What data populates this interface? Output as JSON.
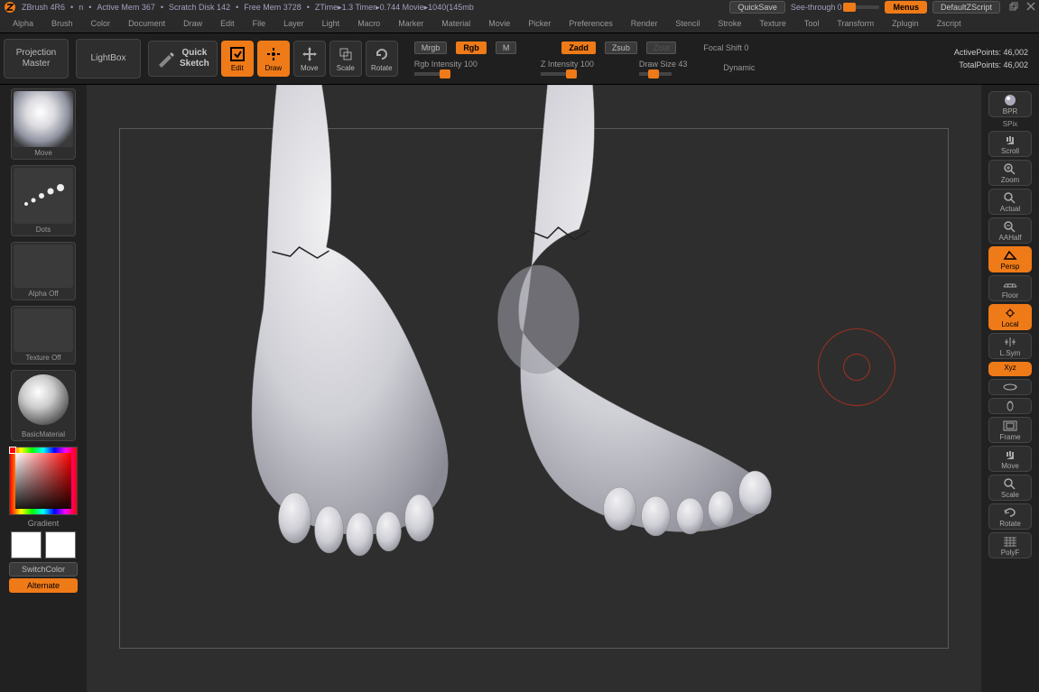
{
  "title": {
    "app": "ZBrush 4R6",
    "segments": [
      "n",
      "Active Mem 367",
      "Scratch Disk 142",
      "Free Mem 3728",
      "ZTime▸1.3  Timer▸0.744  Movie▸1040(145mb"
    ],
    "quicksave": "QuickSave",
    "seethrough_label": "See-through",
    "seethrough_val": "0",
    "menus": "Menus",
    "defaultz": "DefaultZScript"
  },
  "menus": [
    "Alpha",
    "Brush",
    "Color",
    "Document",
    "Draw",
    "Edit",
    "File",
    "Layer",
    "Light",
    "Macro",
    "Marker",
    "Material",
    "Movie",
    "Picker",
    "Preferences",
    "Render",
    "Stencil",
    "Stroke",
    "Texture",
    "Tool",
    "Transform",
    "Zplugin",
    "Zscript"
  ],
  "shelf": {
    "proj_master": "Projection\nMaster",
    "lightbox": "LightBox",
    "quicksketch": "Quick\nSketch",
    "edit": "Edit",
    "draw": "Draw",
    "move": "Move",
    "scale": "Scale",
    "rotate": "Rotate",
    "row1": {
      "mrgb": "Mrgb",
      "rgb": "Rgb",
      "m": "M",
      "zadd": "Zadd",
      "zsub": "Zsub",
      "zcut": "Zcut",
      "focal_shift": "Focal Shift 0"
    },
    "row2": {
      "rgbint": "Rgb Intensity 100",
      "zint": "Z Intensity 100",
      "drawsize": "Draw Size 43",
      "dynamic": "Dynamic"
    },
    "active_pts_lbl": "ActivePoints:",
    "active_pts": "46,002",
    "total_pts_lbl": "TotalPoints:",
    "total_pts": "46,002"
  },
  "left": {
    "brush": "Move",
    "stroke": "Dots",
    "alpha": "Alpha Off",
    "texture": "Texture Off",
    "material": "BasicMaterial",
    "gradient": "Gradient",
    "switchcolor": "SwitchColor",
    "alternate": "Alternate"
  },
  "right": {
    "bpr": "BPR",
    "spix": "SPix",
    "scroll": "Scroll",
    "zoom": "Zoom",
    "actual": "Actual",
    "aahalf": "AAHalf",
    "persp": "Persp",
    "floor": "Floor",
    "local": "Local",
    "lsym": "L.Sym",
    "xyz": "Xyz",
    "frame": "Frame",
    "move": "Move",
    "scale": "Scale",
    "rotate": "Rotate",
    "polyf": "PolyF"
  }
}
